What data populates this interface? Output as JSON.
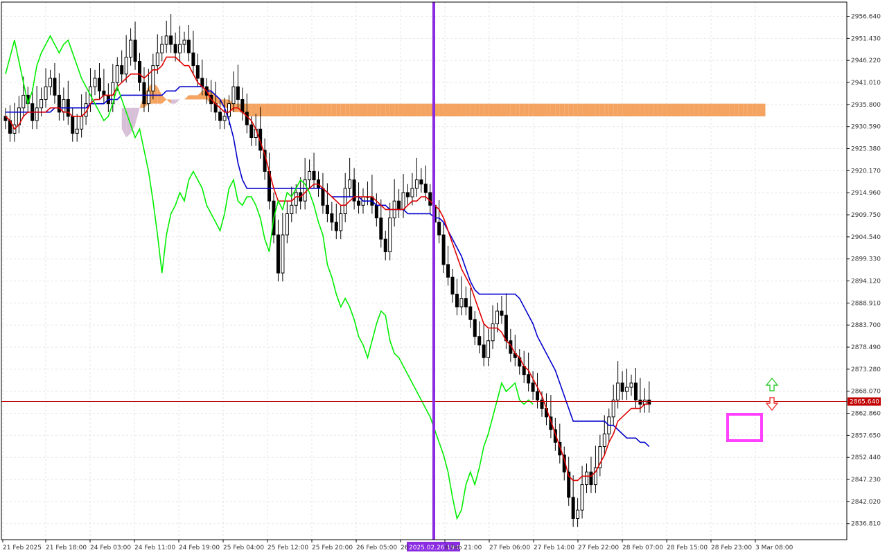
{
  "chart_data": {
    "type": "candlestick",
    "indicator": "Ichimoku Kinko Hyo",
    "y_axis": {
      "side": "right",
      "range": [
        2833.0,
        2960.0
      ],
      "tick_labels": [
        "2956.640",
        "2951.430",
        "2946.220",
        "2941.010",
        "2935.800",
        "2930.590",
        "2925.380",
        "2920.170",
        "2914.960",
        "2909.750",
        "2904.540",
        "2899.330",
        "2894.120",
        "2888.910",
        "2883.700",
        "2878.490",
        "2873.280",
        "2868.070",
        "2862.860",
        "2857.650",
        "2852.440",
        "2847.230",
        "2842.020",
        "2836.810"
      ]
    },
    "x_axis": {
      "tick_labels": [
        "21 Feb 2025",
        "21 Feb 18:00",
        "24 Feb 03:00",
        "24 Feb 11:00",
        "24 Feb 19:00",
        "25 Feb 04:00",
        "25 Feb 12:00",
        "25 Feb 20:00",
        "26 Feb 05:00",
        "26 Feb 13:00",
        "26 Feb 21:00",
        "27 Feb 06:00",
        "27 Feb 14:00",
        "27 Feb 22:00",
        "28 Feb 07:00",
        "28 Feb 15:00",
        "28 Feb 23:00",
        "3 Mar 08:00"
      ],
      "visible_tick_texts": [
        "21 Feb 2025",
        "21 Feb 18:00",
        "24 Feb 03:00",
        "24 Feb 11:00",
        "24 Feb 19:00",
        "25 Feb 04:00",
        "25 Feb 12:00",
        "25 Feb 20:00",
        "26 Feb 05:00",
        "26",
        "6 Feb 21:00",
        "27 Feb 06:00",
        "27 Feb 14:00",
        "27 Feb 22:00",
        "28 Feb 07:00",
        "28 Feb 15:00",
        "28 Feb 23:00",
        "3 Mar 08:00"
      ]
    },
    "current_price": {
      "value": 2865.64,
      "label": "2865.640"
    },
    "vertical_marker": {
      "bar_index": 98,
      "label": "2025.02.26 19:00"
    },
    "colors": {
      "grid": "#e6e6e6",
      "bull_body": "#ffffff",
      "bear_body": "#000000",
      "wick": "#000000",
      "tenkan": "#e00000",
      "kijun": "#0000cc",
      "chikou": "#00ee00",
      "kumo_bull": "#f4a460",
      "kumo_bear": "#d8bfd8",
      "price_line": "#c00000",
      "price_tag": "#c00000",
      "vline": "#8a2be2",
      "highlight_box": "#ff40ff",
      "arrow_up": "#33cc33",
      "arrow_down": "#ee3333"
    },
    "close": [
      2932,
      2929,
      2931,
      2935,
      2938,
      2936,
      2932,
      2935,
      2937,
      2940,
      2942,
      2938,
      2934,
      2937,
      2933,
      2929,
      2930,
      2933,
      2936,
      2940,
      2942,
      2939,
      2938,
      2936,
      2941,
      2945,
      2943,
      2947,
      2951,
      2946,
      2941,
      2936,
      2939,
      2945,
      2948,
      2950,
      2952,
      2950,
      2948,
      2950,
      2951,
      2948,
      2945,
      2942,
      2940,
      2938,
      2936,
      2934,
      2932,
      2933,
      2936,
      2940,
      2937,
      2934,
      2931,
      2928,
      2930,
      2925,
      2920,
      2913,
      2905,
      2896,
      2905,
      2910,
      2912,
      2915,
      2913,
      2918,
      2920,
      2918,
      2916,
      2912,
      2910,
      2908,
      2906,
      2910,
      2916,
      2918,
      2913,
      2912,
      2914,
      2914,
      2912,
      2909,
      2904,
      2901,
      2909,
      2913,
      2911,
      2915,
      2914,
      2916,
      2918,
      2917,
      2915,
      2912,
      2908,
      2905,
      2898,
      2895,
      2891,
      2888,
      2890,
      2888,
      2885,
      2881,
      2879,
      2876,
      2880,
      2884,
      2887,
      2886,
      2880,
      2877,
      2876,
      2874,
      2872,
      2870,
      2868,
      2866,
      2864,
      2862,
      2859,
      2856,
      2853,
      2849,
      2843,
      2838,
      2840,
      2846,
      2849,
      2846,
      2850,
      2855,
      2858,
      2862,
      2866,
      2870,
      2868,
      2869,
      2870,
      2866,
      2865,
      2866,
      2865
    ],
    "tenkan": [
      2933,
      2932,
      2930,
      2931,
      2933,
      2934,
      2934,
      2934,
      2934,
      2934,
      2935,
      2935,
      2935,
      2934,
      2934,
      2933,
      2933,
      2933,
      2934,
      2936,
      2937,
      2937,
      2938,
      2938,
      2938,
      2940,
      2941,
      2942,
      2943,
      2943,
      2943,
      2942,
      2943,
      2944,
      2944,
      2945,
      2947,
      2947,
      2947,
      2946,
      2945,
      2945,
      2943,
      2941,
      2940,
      2939,
      2937,
      2936,
      2935,
      2934,
      2934,
      2935,
      2935,
      2934,
      2933,
      2932,
      2930,
      2927,
      2924,
      2920,
      2916,
      2913,
      2913,
      2913,
      2913,
      2914,
      2914,
      2915,
      2916,
      2917,
      2917,
      2916,
      2915,
      2914,
      2913,
      2912,
      2912,
      2913,
      2914,
      2914,
      2914,
      2914,
      2914,
      2913,
      2912,
      2911,
      2911,
      2911,
      2911,
      2911,
      2912,
      2913,
      2913,
      2914,
      2914,
      2913,
      2912,
      2911,
      2909,
      2906,
      2903,
      2900,
      2897,
      2895,
      2893,
      2890,
      2887,
      2884,
      2883,
      2883,
      2883,
      2882,
      2880,
      2879,
      2877,
      2876,
      2874,
      2873,
      2871,
      2869,
      2867,
      2864,
      2861,
      2858,
      2855,
      2852,
      2848,
      2847,
      2847,
      2848,
      2848,
      2848,
      2849,
      2851,
      2853,
      2856,
      2858,
      2861,
      2862,
      2863,
      2864,
      2864,
      2864,
      2865,
      2865
    ],
    "kijun": [
      2934,
      2934,
      2934,
      2934,
      2934,
      2934,
      2934,
      2934,
      2934,
      2934,
      2934,
      2935,
      2935,
      2935,
      2935,
      2935,
      2935,
      2935,
      2935,
      2936,
      2936,
      2936,
      2936,
      2937,
      2937,
      2937,
      2938,
      2938,
      2938,
      2938,
      2938,
      2938,
      2938,
      2938,
      2938,
      2938,
      2939,
      2939,
      2939,
      2940,
      2940,
      2940,
      2940,
      2940,
      2940,
      2939,
      2939,
      2938,
      2937,
      2935,
      2932,
      2928,
      2922,
      2918,
      2916,
      2916,
      2916,
      2916,
      2916,
      2916,
      2916,
      2916,
      2916,
      2916,
      2916,
      2916,
      2916,
      2916,
      2916,
      2916,
      2916,
      2916,
      2915,
      2914,
      2914,
      2914,
      2914,
      2914,
      2914,
      2914,
      2913,
      2913,
      2913,
      2912,
      2912,
      2912,
      2911,
      2911,
      2911,
      2911,
      2910,
      2910,
      2910,
      2910,
      2910,
      2910,
      2909,
      2909,
      2908,
      2906,
      2904,
      2902,
      2900,
      2897,
      2894,
      2892,
      2891,
      2891,
      2891,
      2891,
      2891,
      2891,
      2891,
      2891,
      2891,
      2890,
      2888,
      2886,
      2884,
      2881,
      2879,
      2877,
      2875,
      2873,
      2870,
      2867,
      2864,
      2861,
      2861,
      2861,
      2861,
      2861,
      2861,
      2861,
      2861,
      2860,
      2860,
      2859,
      2858,
      2857,
      2857,
      2857,
      2856,
      2856,
      2855
    ],
    "chikou_shift": 26,
    "cloud_span_a": [
      2930,
      2928,
      2929,
      2931,
      2935,
      2938,
      2940,
      2941,
      2940,
      2938,
      2937,
      2936,
      2936,
      2937,
      2937,
      2938,
      2938,
      2938,
      2939,
      2940,
      2939,
      2938,
      2937,
      2937,
      2937,
      2936,
      2936,
      2936,
      2936,
      2936,
      2936,
      2936,
      2936,
      2936,
      2936,
      2936,
      2936,
      2936,
      2936,
      2936,
      2936,
      2936,
      2936,
      2936,
      2936,
      2936,
      2936,
      2936,
      2936,
      2936,
      2936,
      2936,
      2936,
      2936,
      2936,
      2936,
      2936,
      2936,
      2936,
      2936,
      2936,
      2936,
      2936,
      2936,
      2936,
      2936,
      2936,
      2936,
      2936,
      2936,
      2936,
      2936,
      2936,
      2936,
      2936,
      2936,
      2936,
      2936,
      2936,
      2936,
      2936,
      2936,
      2936,
      2936,
      2936,
      2936,
      2936,
      2936,
      2936,
      2936,
      2936,
      2936,
      2936,
      2936,
      2936,
      2936,
      2936,
      2936,
      2936,
      2936,
      2936,
      2936,
      2936,
      2936,
      2936,
      2936,
      2936,
      2936,
      2936,
      2936,
      2936,
      2936,
      2936,
      2936,
      2936,
      2936,
      2936,
      2936,
      2936,
      2936,
      2936,
      2936,
      2936,
      2936,
      2936,
      2936,
      2936,
      2936,
      2936,
      2936,
      2936,
      2936,
      2936,
      2936,
      2936,
      2936,
      2936,
      2936,
      2936,
      2936,
      2936,
      2936,
      2936,
      2936,
      2936
    ],
    "cloud_span_b": [
      2935,
      2935,
      2935,
      2935,
      2935,
      2935,
      2936,
      2936,
      2936,
      2936,
      2937,
      2937,
      2937,
      2937,
      2937,
      2937,
      2937,
      2937,
      2937,
      2937,
      2936,
      2936,
      2936,
      2935,
      2935,
      2934,
      2934,
      2934,
      2933,
      2933,
      2933,
      2933,
      2933,
      2933,
      2933,
      2933,
      2933,
      2933,
      2933,
      2933,
      2933,
      2933,
      2933,
      2933,
      2933,
      2933,
      2933,
      2933,
      2933,
      2933,
      2933,
      2933,
      2933,
      2933,
      2933,
      2933,
      2933,
      2933,
      2933,
      2933,
      2933,
      2933,
      2933,
      2933,
      2933,
      2933,
      2933,
      2933,
      2933,
      2933,
      2933,
      2933,
      2933,
      2933,
      2933,
      2933,
      2933,
      2933,
      2933,
      2933,
      2933,
      2933,
      2933,
      2933,
      2933,
      2933,
      2933,
      2933,
      2933,
      2933,
      2933,
      2933,
      2933,
      2933,
      2933,
      2933,
      2933,
      2933,
      2933,
      2933,
      2933,
      2933,
      2933,
      2933,
      2933,
      2933,
      2933,
      2933,
      2933,
      2933,
      2933,
      2933,
      2933,
      2933,
      2933,
      2933,
      2933,
      2933,
      2933,
      2933,
      2933,
      2933,
      2933,
      2933,
      2933,
      2933,
      2933,
      2933,
      2933,
      2933,
      2933,
      2933,
      2933,
      2933,
      2933,
      2933,
      2933,
      2933,
      2933,
      2933,
      2933,
      2933,
      2933,
      2933,
      2933
    ]
  }
}
